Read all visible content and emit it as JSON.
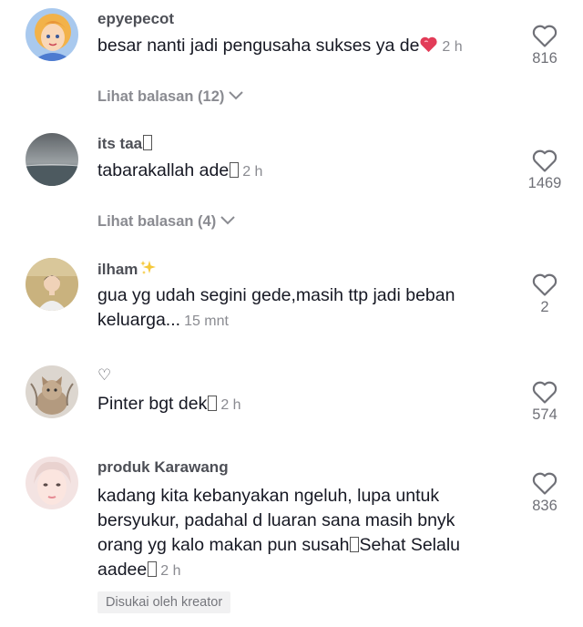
{
  "comments": [
    {
      "username": "epyepecot",
      "text": "besar nanti jadi pengusaha sukses ya de",
      "time": "2 h",
      "likes": "816",
      "replies": "Lihat balasan (12)",
      "avatar_icon": "cartoon-avatar"
    },
    {
      "username": "its taa",
      "text": "tabarakallah ade",
      "time": "2 h",
      "likes": "1469",
      "replies": "Lihat balasan (4)",
      "avatar_icon": "landscape-avatar"
    },
    {
      "username": "ilham",
      "text": "gua yg udah segini gede,masih ttp jadi beban keluarga...",
      "time": "15 mnt",
      "likes": "2",
      "avatar_icon": "person-avatar"
    },
    {
      "username": "♡",
      "text": "Pinter bgt dek",
      "time": "2 h",
      "likes": "574",
      "avatar_icon": "cat-avatar"
    },
    {
      "username": "produk Karawang",
      "text_part1": "kadang kita kebanyakan ngeluh, lupa untuk bersyukur, padahal d luaran sana masih bnyk orang yg kalo makan pun susah",
      "text_part2": "Sehat Selalu aadee",
      "time": "2 h",
      "likes": "836",
      "badge": "Disukai oleh kreator",
      "avatar_icon": "face-avatar"
    }
  ],
  "colors": {
    "text": "#161823",
    "secondary": "#8a8b91",
    "like_outline": "#6f7077"
  }
}
